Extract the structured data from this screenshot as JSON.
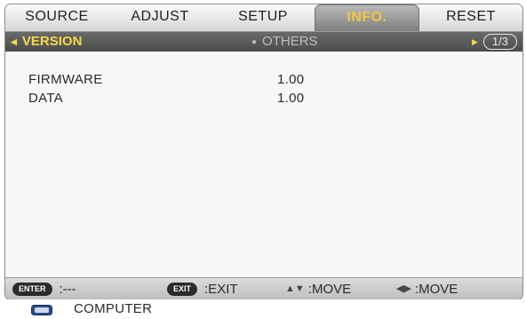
{
  "tabs": [
    {
      "label": "SOURCE",
      "active": false
    },
    {
      "label": "ADJUST",
      "active": false
    },
    {
      "label": "SETUP",
      "active": false
    },
    {
      "label": "INFO.",
      "active": true
    },
    {
      "label": "RESET",
      "active": false
    }
  ],
  "subheader": {
    "left": "VERSION",
    "center": "OTHERS",
    "page": "1/3"
  },
  "info_rows": [
    {
      "label": "FIRMWARE",
      "value": "1.00"
    },
    {
      "label": "DATA",
      "value": "1.00"
    }
  ],
  "help": {
    "enter_key": "ENTER",
    "enter_text": ":---",
    "exit_key": "EXIT",
    "exit_text": ":EXIT",
    "move_updown_text": ":MOVE",
    "move_leftright_text": ":MOVE"
  },
  "source": {
    "label": "COMPUTER",
    "icon": "computer-input-icon"
  },
  "colors": {
    "accent_yellow": "#f3d84a",
    "active_tab_text": "#f0c640",
    "subbar_bg": "#555555"
  }
}
